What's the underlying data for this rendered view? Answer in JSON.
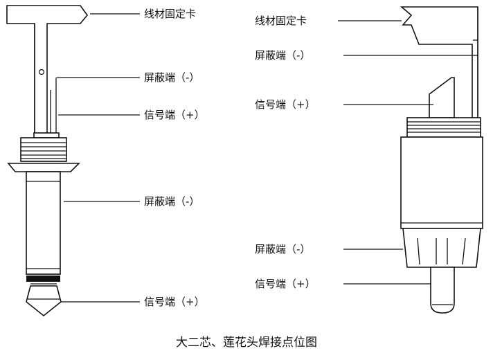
{
  "caption": "大二芯、莲花头焊接点位图",
  "left_plug": {
    "labels": {
      "clamp": "线材固定卡",
      "shield_top": "屏蔽端（-）",
      "signal_top": "信号端（+）",
      "shield_sleeve": "屏蔽端（-）",
      "signal_tip": "信号端（+）"
    }
  },
  "right_plug": {
    "labels": {
      "clamp": "线材固定卡",
      "shield_top": "屏蔽端（-）",
      "signal_top": "信号端（+）",
      "shield_sleeve": "屏蔽端（-）",
      "signal_tip": "信号端（+）"
    }
  }
}
